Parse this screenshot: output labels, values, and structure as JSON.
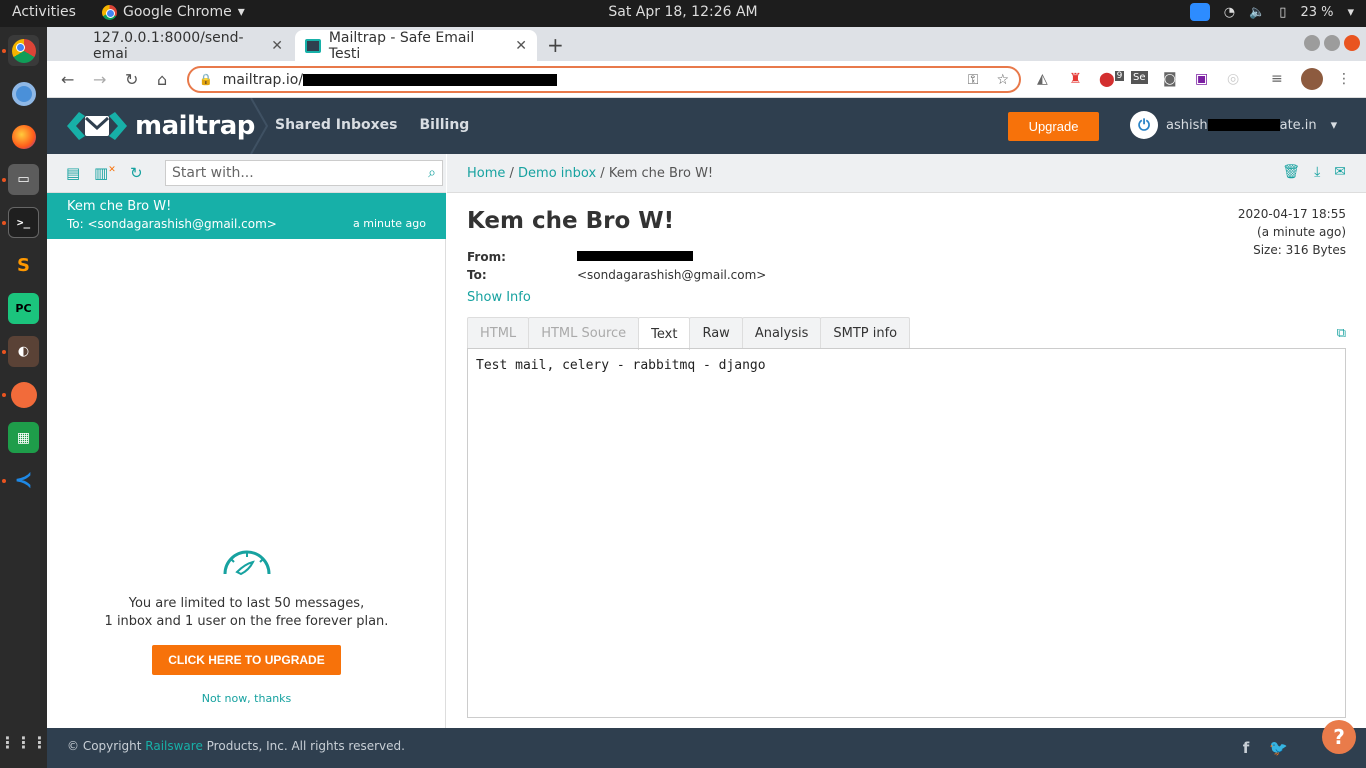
{
  "system_bar": {
    "activities": "Activities",
    "app_name": "Google Chrome",
    "clock": "Sat Apr 18, 12:26 AM",
    "battery": "23 %"
  },
  "browser": {
    "tabs": [
      {
        "title": "127.0.0.1:8000/send-emai"
      },
      {
        "title": "Mailtrap - Safe Email Testi"
      }
    ],
    "url_prefix": "mailtrap.io/",
    "extension_badge": "9"
  },
  "mailtrap": {
    "logo_text": "mailtrap",
    "nav": [
      "Shared Inboxes",
      "Billing"
    ],
    "upgrade_label": "Upgrade",
    "user_prefix": "ashish",
    "user_suffix": "ate.in"
  },
  "inbox": {
    "search_placeholder": "Start with...",
    "message": {
      "subject": "Kem che Bro W!",
      "to": "To: <sondagarashish@gmail.com>",
      "time": "a minute ago"
    },
    "limit_line1": "You are limited to last 50 messages,",
    "limit_line2": "1 inbox and 1 user on the free forever plan.",
    "cta_label": "CLICK HERE TO UPGRADE",
    "not_now": "Not now, thanks"
  },
  "viewer": {
    "breadcrumb": [
      "Home",
      "Demo inbox",
      "Kem che Bro W!"
    ],
    "subject": "Kem che Bro W!",
    "date": "2020-04-17 18:55",
    "relative": "(a minute ago)",
    "size": "Size: 316 Bytes",
    "from_label": "From:",
    "to_label": "To:",
    "to_value": "<sondagarashish@gmail.com>",
    "show_info": "Show Info",
    "tabs": [
      "HTML",
      "HTML Source",
      "Text",
      "Raw",
      "Analysis",
      "SMTP info"
    ],
    "active_tab": "Text",
    "body_text": "Test mail, celery - rabbitmq - django"
  },
  "footer": {
    "copy_pre": "© Copyright ",
    "copy_link": "Railsware",
    "copy_post": " Products, Inc. All rights reserved.",
    "help": "?"
  },
  "colors": {
    "accent": "#17b0a8",
    "orange": "#f7720a",
    "header": "#2f3f4f"
  }
}
